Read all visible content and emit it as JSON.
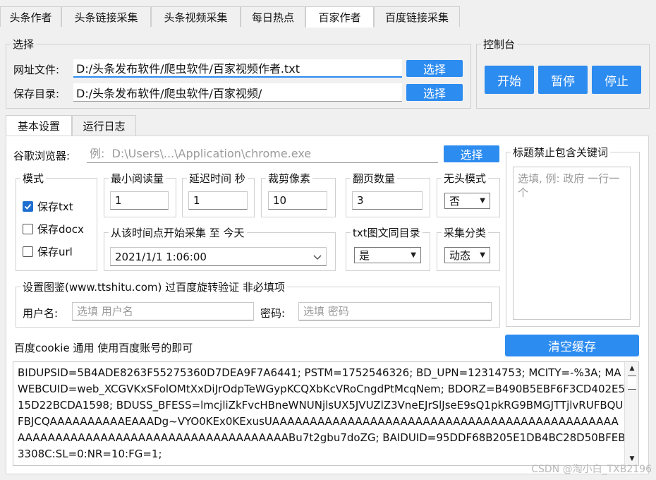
{
  "top_tabs": [
    "头条作者",
    "头条链接采集",
    "头条视频采集",
    "每日热点",
    "百家作者",
    "百度链接采集"
  ],
  "select_group": {
    "legend": "选择",
    "url_file_label": "网址文件:",
    "url_file_value": "D:/头条发布软件/爬虫软件/百家视频作者.txt",
    "save_dir_label": "保存目录:",
    "save_dir_value": "D:/头条发布软件/爬虫软件/百家视频/",
    "choose_label": "选择"
  },
  "console": {
    "legend": "控制台",
    "start": "开始",
    "pause": "暂停",
    "stop": "停止"
  },
  "sub_tabs": [
    "基本设置",
    "运行日志"
  ],
  "browser": {
    "label": "谷歌浏览器:",
    "placeholder": "例:  D:\\Users\\...\\Application\\chrome.exe",
    "choose_label": "选择"
  },
  "mode": {
    "legend": "模式",
    "options": [
      {
        "label": "保存txt",
        "checked": true
      },
      {
        "label": "保存docx",
        "checked": false
      },
      {
        "label": "保存url",
        "checked": false
      }
    ]
  },
  "min_read": {
    "legend": "最小阅读量",
    "value": "1"
  },
  "delay": {
    "legend": "延迟时间 秒",
    "value": "1"
  },
  "crop": {
    "legend": "裁剪像素",
    "value": "10"
  },
  "pages": {
    "legend": "翻页数量",
    "value": "3"
  },
  "headless": {
    "legend": "无头模式",
    "value": "否"
  },
  "time_range": {
    "legend": "从该时间点开始采集 至 今天",
    "value": "2021/1/1  1:06:00"
  },
  "same_dir": {
    "legend": "txt图文同目录",
    "value": "是"
  },
  "category": {
    "legend": "采集分类",
    "value": "动态"
  },
  "keywords": {
    "legend": "标题禁止包含关键词",
    "placeholder": "选填, 例: 政府 一行一个"
  },
  "ttshitu": {
    "legend": "设置图鉴(www.ttshitu.com) 过百度旋转验证 非必填项",
    "user_label": "用户名:",
    "user_placeholder": "选填 用户名",
    "pass_label": "密码:",
    "pass_placeholder": "选填 密码"
  },
  "cookie": {
    "label": "百度cookie 通用 使用百度账号的即可",
    "clear_label": "清空缓存",
    "text": "BIDUPSID=5B4ADE8263F55275360D7DEA9F7A6441; PSTM=1752546326; BD_UPN=12314753; MCITY=-%3A; MAWEBCUID=web_XCGVKxSFolOMtXxDiJrOdpTeWGypKCQXbKcVRoCngdPtMcqNem; BDORZ=B490B5EBF6F3CD402E515D22BCDA1598; BDUSS_BFESS=lmcjliZkFvcHBneWNUNjlsUX5JVUZlZ3VneEJrSlJseE9sQ1pkRG9BMGJTTjlvRUFBQUFBJCQAAAAAAAAAAEAAADg~VYO0KEx0KExusUAAAAAAAAAAAAAAAAAAAAAAAAAAAAAAAAAAAAAAAAAAAAAAAAAAAAAAAAAAAAAAAAAAAAAAAAAAAAAAAAAABu7t2gbu7doZG; BAIDUID=95DDF68B205E1DB4BC28D50BFEB3308C:SL=0:NR=10:FG=1;"
  },
  "watermark": "CSDN @淘小白_TXB2196"
}
